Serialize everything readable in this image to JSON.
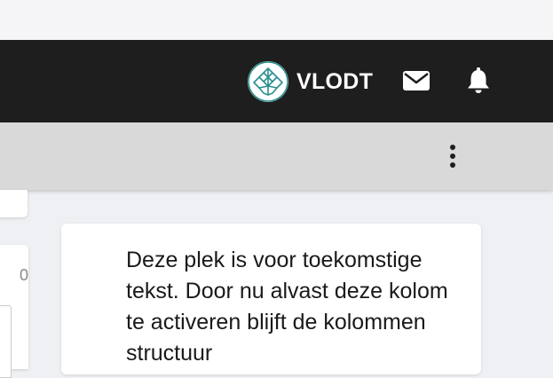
{
  "header": {
    "brand_name": "VLODT",
    "logo_icon": "tree-logo-icon",
    "mail_icon": "mail-icon",
    "bell_icon": "bell-icon"
  },
  "toolbar": {
    "menu_icon": "kebab-menu-icon"
  },
  "left_card": {
    "value": "0"
  },
  "info_card": {
    "text": "Deze plek is voor toekomstige tekst. Door nu alvast deze kolom te activeren blijft de kolommen structuur"
  },
  "colors": {
    "navbar_bg": "#1e1e1e",
    "subbar_bg": "#d9d9d9",
    "page_bg": "#eef0f3",
    "logo_accent": "#2a8f8f"
  }
}
